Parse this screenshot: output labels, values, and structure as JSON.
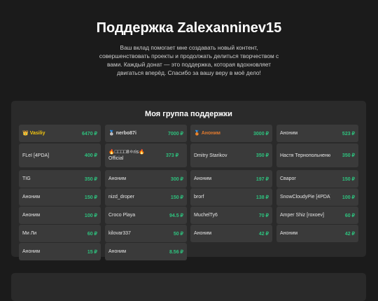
{
  "page": {
    "title": "Поддержка Zalexanninev15",
    "subtitle": "Ваш вклад помогает мне создавать новый контент, совершенствовать проекты и продолжать делиться творчеством с вами. Каждый донат — это поддержка, которая вдохновляет двигаться вперёд. Спасибо за вашу веру в моё дело!"
  },
  "group": {
    "title": "Моя группа поддержки",
    "supporters": [
      {
        "name": "Vasiliy",
        "amount": "6470 ₽",
        "rank": "gold",
        "icon": "gold-medal-icon",
        "glyph": "👑"
      },
      {
        "name": "nerbo87i",
        "amount": "7000 ₽",
        "rank": "silver",
        "icon": "silver-medal-icon",
        "glyph": "🥈"
      },
      {
        "name": "Аноним",
        "amount": "3000 ₽",
        "rank": "bronze",
        "icon": "bronze-medal-icon",
        "glyph": "🥉"
      },
      {
        "name": "Аноним",
        "amount": "523 ₽"
      },
      {
        "name": "FLeI [4PDA]",
        "amount": "400 ₽"
      },
      {
        "name": "🔥□□□□8⚛ris🔥 Official",
        "amount": "373 ₽"
      },
      {
        "name": "Dmitry Starikov",
        "amount": "350 ₽"
      },
      {
        "name": "Настя Тернопольненко",
        "amount": "350 ₽"
      },
      {
        "name": "TIG",
        "amount": "350 ₽"
      },
      {
        "name": "Аноним",
        "amount": "300 ₽"
      },
      {
        "name": "Аноним",
        "amount": "197 ₽"
      },
      {
        "name": "Сварог",
        "amount": "150 ₽"
      },
      {
        "name": "Аноним",
        "amount": "150 ₽"
      },
      {
        "name": "nizd_droper",
        "amount": "150 ₽"
      },
      {
        "name": "brorf",
        "amount": "138 ₽"
      },
      {
        "name": "SnowCloudyPie [4PDA]",
        "amount": "100 ₽"
      },
      {
        "name": "Аноним",
        "amount": "100 ₽"
      },
      {
        "name": "Croco Playa",
        "amount": "94.5 ₽"
      },
      {
        "name": "MuchelTy6",
        "amount": "70 ₽"
      },
      {
        "name": "Amper Shiz [гохоеv]",
        "amount": "60 ₽"
      },
      {
        "name": "Ми Ли",
        "amount": "60 ₽"
      },
      {
        "name": "kilovar337",
        "amount": "50 ₽"
      },
      {
        "name": "Аноним",
        "amount": "42 ₽"
      },
      {
        "name": "Аноним",
        "amount": "42 ₽"
      },
      {
        "name": "Аноним",
        "amount": "15 ₽"
      },
      {
        "name": "Аноним",
        "amount": "8.56 ₽"
      }
    ]
  },
  "colors": {
    "background": "#1b1b1b",
    "panel": "#2a2a2a",
    "card": "#3a3a3a",
    "amount_green": "#2ec27e",
    "gold": "#f1c40f",
    "bronze": "#e07a2f"
  }
}
